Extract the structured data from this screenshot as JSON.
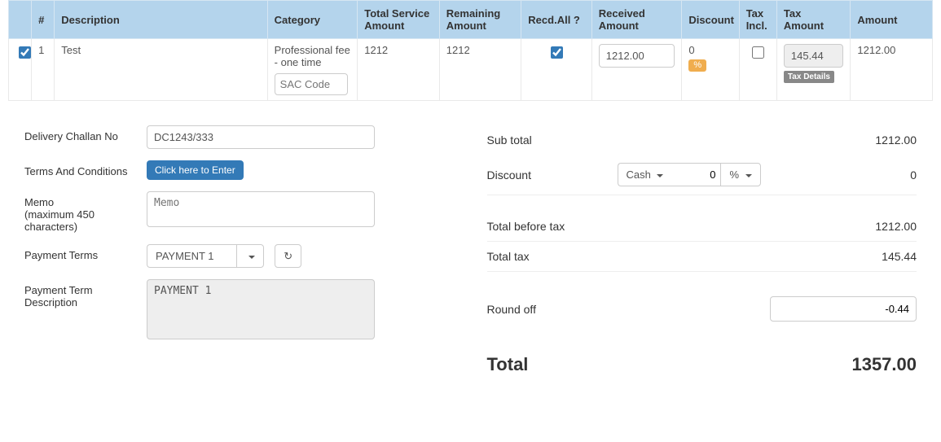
{
  "table": {
    "headers": {
      "num": "#",
      "description": "Description",
      "category": "Category",
      "total_service_amount": "Total Service Amount",
      "remaining_amount": "Remaining Amount",
      "recd_all": "Recd.All ?",
      "received_amount": "Received Amount",
      "discount": "Discount",
      "tax_incl": "Tax Incl.",
      "tax_amount": "Tax Amount",
      "amount": "Amount"
    },
    "row": {
      "num": "1",
      "description": "Test",
      "category": "Professional fee - one time",
      "sac_placeholder": "SAC Code",
      "total_service_amount": "1212",
      "remaining_amount": "1212",
      "recd_all_checked": true,
      "received_amount": "1212.00",
      "discount": "0",
      "percent_badge": "%",
      "tax_incl_checked": false,
      "tax_amount": "145.44",
      "tax_details_label": "Tax Details",
      "amount": "1212.00"
    }
  },
  "left": {
    "delivery_challan_label": "Delivery Challan No",
    "delivery_challan_value": "DC1243/333",
    "terms_label": "Terms And Conditions",
    "terms_button": "Click here to Enter",
    "memo_label": "Memo\n(maximum 450 characters)",
    "memo_placeholder": "Memo",
    "payment_terms_label": "Payment Terms",
    "payment_terms_value": "PAYMENT 1",
    "payment_term_desc_label": "Payment Term Description",
    "payment_term_desc_value": "PAYMENT 1"
  },
  "right": {
    "subtotal_label": "Sub total",
    "subtotal_value": "1212.00",
    "discount_label": "Discount",
    "discount_type": "Cash",
    "discount_value": "0",
    "discount_unit": "%",
    "discount_amount": "0",
    "total_before_tax_label": "Total before tax",
    "total_before_tax_value": "1212.00",
    "total_tax_label": "Total tax",
    "total_tax_value": "145.44",
    "roundoff_label": "Round off",
    "roundoff_value": "-0.44",
    "total_label": "Total",
    "total_value": "1357.00"
  }
}
